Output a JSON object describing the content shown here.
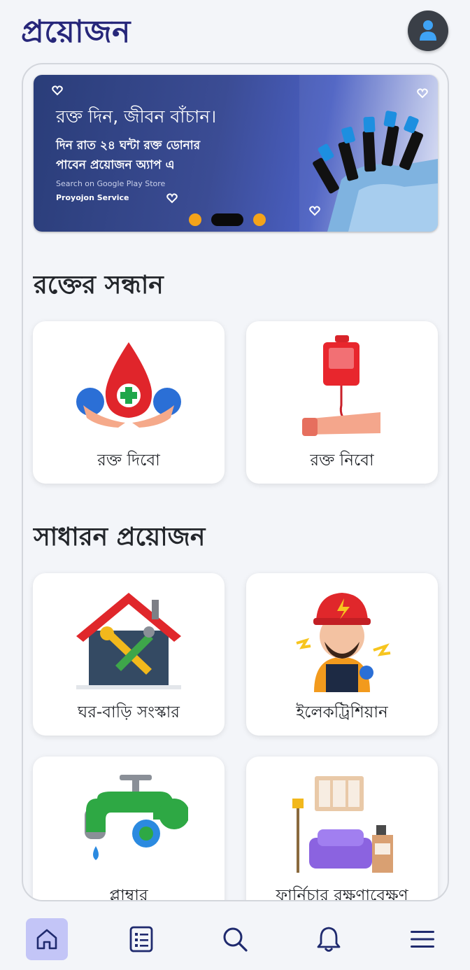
{
  "app": {
    "title": "প্রয়োজন"
  },
  "banner": {
    "headline": "রক্ত দিন, জীবন বাঁচান।",
    "line1": "দিন রাত ২৪ ঘন্টা রক্ত ডোনার",
    "line2": "পাবেন প্রয়োজন অ্যাপ এ",
    "store_text": "Search on Google Play Store",
    "brand_text": "Proyojon Service",
    "active_slide": 2,
    "slide_count": 3
  },
  "blood_section": {
    "title": "রক্তের সন্ধান",
    "cards": [
      {
        "label": "রক্ত দিবো",
        "icon": "blood-drop-hands-icon"
      },
      {
        "label": "রক্ত নিবো",
        "icon": "blood-bag-arm-icon"
      }
    ]
  },
  "general_section": {
    "title": "সাধারন প্রয়োজন",
    "cards": [
      {
        "label": "ঘর-বাড়ি সংস্কার",
        "icon": "house-repair-icon"
      },
      {
        "label": "ইলেকট্রিশিয়ান",
        "icon": "electrician-icon"
      },
      {
        "label": "প্লাম্বার",
        "icon": "water-tap-icon"
      },
      {
        "label": "ফার্নিচার রক্ষণাবেক্ষণ",
        "icon": "furniture-icon"
      }
    ]
  },
  "nav": {
    "items": [
      {
        "name": "home",
        "icon": "home-icon",
        "active": true
      },
      {
        "name": "list",
        "icon": "list-icon",
        "active": false
      },
      {
        "name": "search",
        "icon": "search-icon",
        "active": false
      },
      {
        "name": "notifications",
        "icon": "bell-icon",
        "active": false
      },
      {
        "name": "menu",
        "icon": "menu-icon",
        "active": false
      }
    ]
  },
  "colors": {
    "brand": "#27277a",
    "accent": "#f4a31a",
    "nav_active_bg": "#c3c5f7",
    "nav_icon": "#1f2a6e"
  }
}
